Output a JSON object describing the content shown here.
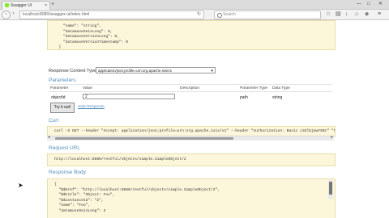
{
  "browser": {
    "tab_title": "Swagger UI",
    "tab_close": "×",
    "new_tab": "+",
    "url": "localhost:8080/swagger-ui/index.html",
    "search_placeholder": "Search",
    "win_min": "—",
    "win_max": "□",
    "win_close": "✕"
  },
  "model_schema": {
    "lines": [
      "    \"name\": \"string\",",
      "    \"datamuseSeizLong\": 0,",
      "    \"datamuseVersionLong\": 0,",
      "    \"datamuseVersionTimestamp\": 0",
      "  }"
    ]
  },
  "response_content_type": {
    "label": "Response Content Type",
    "value": "application/json;profile=urn:org.apache.isis/v1"
  },
  "parameters": {
    "heading": "Parameters",
    "columns": [
      "Parameter",
      "Value",
      "Description",
      "Parameter Type",
      "Data Type"
    ],
    "row": {
      "name": "objectId",
      "value": "2",
      "description": "",
      "param_type": "path",
      "data_type": "string"
    }
  },
  "try_button": "Try it out!",
  "hide_response": "Hide Response",
  "curl": {
    "heading": "Curl",
    "command": "curl -X GET --header \"Accept: application/json;profile=urn:org.apache.isis/v1\" --header \"Authorization: Basic c3ZlbjpwYXNz\" \"http://"
  },
  "request_url": {
    "heading": "Request URL",
    "value": "http://localhost:8080/restful/objects/simple.SimpleObject/2"
  },
  "response_body": {
    "heading": "Response Body",
    "lines": [
      "{",
      "  \"$$href\": \"http://localhost:8080/restful/objects/simple.SimpleObject/2\",",
      "  \"$$title\": \"Object: Foo\",",
      "  \"$$instanceId\": \"2\",",
      "  \"name\": \"Foo\",",
      "  \"datamuseSeizLong\": 2"
    ]
  },
  "colors": {
    "heading": "#548fbd",
    "code_bg": "#fcf6db",
    "swagger_green": "#85ea2d"
  }
}
